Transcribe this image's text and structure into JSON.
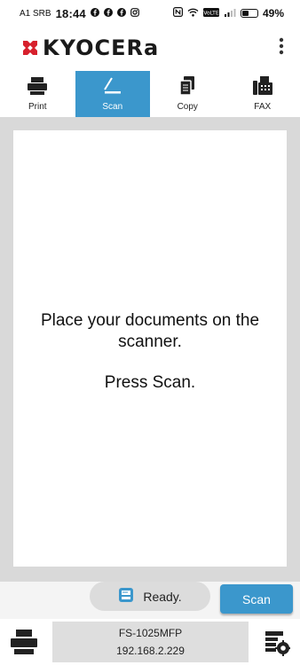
{
  "status_bar": {
    "carrier": "A1 SRB",
    "time": "18:44",
    "notif_icons": [
      "facebook-icon",
      "facebook-icon",
      "facebook-icon",
      "instagram-icon"
    ],
    "right_icons": [
      "nfc-icon",
      "wifi-icon",
      "volte-icon",
      "signal-icon"
    ],
    "volte_label": "VoLTE",
    "battery_percent": "49%",
    "battery_level": 0.49
  },
  "header": {
    "brand": "KYOCERa",
    "menu_icon": "more-vert-icon"
  },
  "tabs": [
    {
      "label": "Print",
      "icon": "printer-icon",
      "active": false
    },
    {
      "label": "Scan",
      "icon": "scanner-icon",
      "active": true
    },
    {
      "label": "Copy",
      "icon": "copy-icon",
      "active": false
    },
    {
      "label": "FAX",
      "icon": "fax-icon",
      "active": false
    }
  ],
  "main": {
    "instruction": "Place your documents on the scanner.",
    "prompt": "Press Scan."
  },
  "actions": {
    "status_text": "Ready.",
    "status_icon": "device-status-icon",
    "scan_label": "Scan"
  },
  "device": {
    "model": "FS-1025MFP",
    "ip": "192.168.2.229"
  },
  "colors": {
    "accent": "#3b97cc",
    "logo_red": "#d7212d",
    "background": "#d9d9d9"
  }
}
